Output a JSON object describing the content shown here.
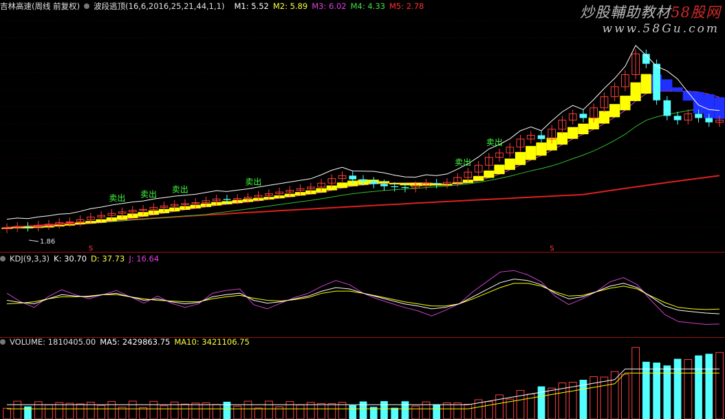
{
  "header": {
    "stock": "吉林高速(周线 前复权)",
    "indicator": "波段逃顶(16,6,2016,25,21,44,1,1)",
    "m1": "M1: 5.52",
    "m2": "M2: 5.89",
    "m3": "M3: 6.02",
    "m4": "M4: 4.33",
    "m5": "M5: 2.78"
  },
  "watermark": {
    "line1_pre": "炒股輔助教材",
    "line1_brand": "58股网",
    "line2": "www.58Gu.com"
  },
  "price_axis_label": "1.86",
  "sell_label": "卖出",
  "marker_label": "S",
  "kdj_header": {
    "name": "KDJ(9,3,3)",
    "k": "K: 30.70",
    "d": "D: 37.73",
    "j": "J: 16.64"
  },
  "volume_header": {
    "name": "VOLUME: 1810405.00",
    "ma5": "MA5: 2429863.75",
    "ma10": "MA10: 3421106.75"
  },
  "colors": {
    "up": "#ff4040",
    "down": "#54ffff",
    "ma_white": "#ffffff",
    "ma_yellow": "#ffff00",
    "ma_purple": "#d040d0",
    "ma_green": "#30c030",
    "ma_red": "#e02020",
    "band": "#ffff00",
    "band_blue": "#2030ff",
    "sell": "#40ff40"
  },
  "chart_data": {
    "type": "candlestick",
    "closes": [
      1.86,
      1.88,
      1.87,
      1.9,
      1.92,
      1.95,
      1.96,
      2.0,
      2.05,
      2.08,
      2.12,
      2.15,
      2.18,
      2.2,
      2.24,
      2.27,
      2.3,
      2.32,
      2.34,
      2.38,
      2.42,
      2.4,
      2.43,
      2.46,
      2.5,
      2.54,
      2.58,
      2.62,
      2.66,
      2.7,
      2.8,
      2.92,
      3.0,
      2.9,
      2.85,
      2.78,
      2.72,
      2.7,
      2.68,
      2.74,
      2.8,
      2.78,
      2.82,
      2.95,
      3.1,
      3.3,
      3.55,
      3.7,
      3.9,
      4.2,
      4.35,
      4.2,
      4.6,
      5.0,
      5.3,
      5.1,
      5.6,
      6.2,
      6.8,
      7.6,
      9.2,
      8.4,
      6.0,
      5.2,
      5.0,
      5.3,
      5.1,
      4.9,
      5.0
    ],
    "kdj_k": [
      50,
      47,
      45,
      52,
      58,
      56,
      55,
      58,
      60,
      55,
      50,
      52,
      48,
      45,
      47,
      55,
      58,
      60,
      50,
      46,
      48,
      52,
      56,
      63,
      68,
      66,
      60,
      55,
      50,
      45,
      42,
      38,
      40,
      45,
      55,
      65,
      75,
      80,
      78,
      72,
      60,
      52,
      55,
      62,
      70,
      74,
      68,
      55,
      42,
      36,
      34,
      32,
      31
    ],
    "kdj_d": [
      45,
      46,
      48,
      52,
      55,
      55,
      56,
      58,
      58,
      55,
      52,
      50,
      49,
      48,
      48,
      52,
      55,
      57,
      53,
      50,
      49,
      51,
      54,
      60,
      63,
      63,
      60,
      56,
      52,
      48,
      45,
      42,
      42,
      45,
      52,
      60,
      68,
      74,
      74,
      70,
      62,
      56,
      57,
      62,
      67,
      70,
      66,
      56,
      47,
      40,
      38,
      37,
      37.7
    ],
    "kdj_j": [
      60,
      48,
      40,
      55,
      65,
      58,
      52,
      58,
      64,
      55,
      46,
      56,
      46,
      40,
      45,
      60,
      64,
      66,
      44,
      38,
      46,
      54,
      60,
      70,
      78,
      72,
      60,
      52,
      46,
      40,
      35,
      28,
      36,
      45,
      62,
      76,
      90,
      92,
      86,
      76,
      56,
      44,
      52,
      62,
      76,
      82,
      72,
      50,
      30,
      20,
      18,
      16,
      16.6
    ],
    "volume_ma5": "2429863.75",
    "volume_ma10": "3421106.75"
  }
}
